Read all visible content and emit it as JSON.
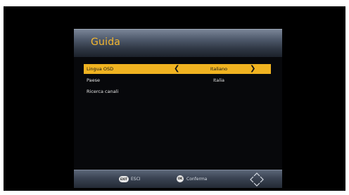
{
  "header": {
    "title": "Guida"
  },
  "menu": {
    "items": [
      {
        "label": "Lingua OSD",
        "value": "Italiano",
        "selected": true,
        "left_arrow": "❮",
        "right_arrow": "❯"
      },
      {
        "label": "Paese",
        "value": "Italia",
        "selected": false
      },
      {
        "label": "Ricerca canali",
        "value": "",
        "selected": false
      }
    ]
  },
  "footer": {
    "exit": {
      "key": "EXIT",
      "label": "ESCI"
    },
    "ok": {
      "key": "OK",
      "label": "Conferma"
    },
    "nav_icon": "navigation-arrows-icon"
  },
  "colors": {
    "accent": "#f0b321",
    "title": "#f5b830",
    "background": "#000000"
  }
}
